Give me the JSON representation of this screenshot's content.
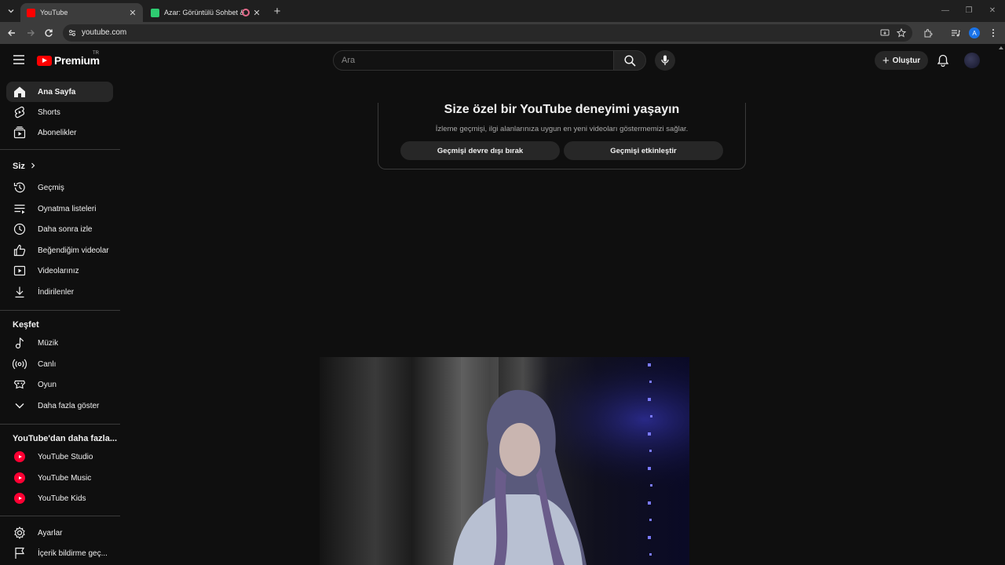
{
  "browser": {
    "tabs": [
      {
        "title": "YouTube",
        "favicon_color": "#ff0000",
        "active": true
      },
      {
        "title": "Azar: Görüntülü Sohbet & Y",
        "favicon_color": "#2ecc71",
        "active": false
      }
    ],
    "url": "youtube.com",
    "profile_initial": "A"
  },
  "masthead": {
    "brand": "Premium",
    "region": "TR",
    "search_placeholder": "Ara",
    "create_label": "Oluştur"
  },
  "sidebar": {
    "main": [
      {
        "label": "Ana Sayfa",
        "icon": "home-icon",
        "active": true
      },
      {
        "label": "Shorts",
        "icon": "shorts-icon"
      },
      {
        "label": "Abonelikler",
        "icon": "subscriptions-icon"
      }
    ],
    "you_title": "Siz",
    "you": [
      {
        "label": "Geçmiş",
        "icon": "history-icon"
      },
      {
        "label": "Oynatma listeleri",
        "icon": "playlists-icon"
      },
      {
        "label": "Daha sonra izle",
        "icon": "watch-later-icon"
      },
      {
        "label": "Beğendiğim videolar",
        "icon": "like-icon"
      },
      {
        "label": "Videolarınız",
        "icon": "your-videos-icon"
      },
      {
        "label": "İndirilenler",
        "icon": "download-icon"
      }
    ],
    "explore_title": "Keşfet",
    "explore": [
      {
        "label": "Müzik",
        "icon": "music-icon"
      },
      {
        "label": "Canlı",
        "icon": "live-icon"
      },
      {
        "label": "Oyun",
        "icon": "gaming-icon"
      },
      {
        "label": "Daha fazla göster",
        "icon": "chevron-down-icon"
      }
    ],
    "more_title": "YouTube'dan daha fazla...",
    "more": [
      {
        "label": "YouTube Studio",
        "icon": "youtube-studio-icon"
      },
      {
        "label": "YouTube Music",
        "icon": "youtube-music-icon"
      },
      {
        "label": "YouTube Kids",
        "icon": "youtube-kids-icon"
      }
    ],
    "bottom": [
      {
        "label": "Ayarlar",
        "icon": "settings-icon"
      },
      {
        "label": "İçerik bildirme geç...",
        "icon": "flag-icon"
      }
    ]
  },
  "history_prompt": {
    "title": "Size özel bir YouTube deneyimi yaşayın",
    "description": "İzleme geçmişi, ilgi alanlarınıza uygun en yeni videoları göstermemizi sağlar.",
    "disable_button": "Geçmişi devre dışı bırak",
    "enable_button": "Geçmişi etkinleştir"
  }
}
